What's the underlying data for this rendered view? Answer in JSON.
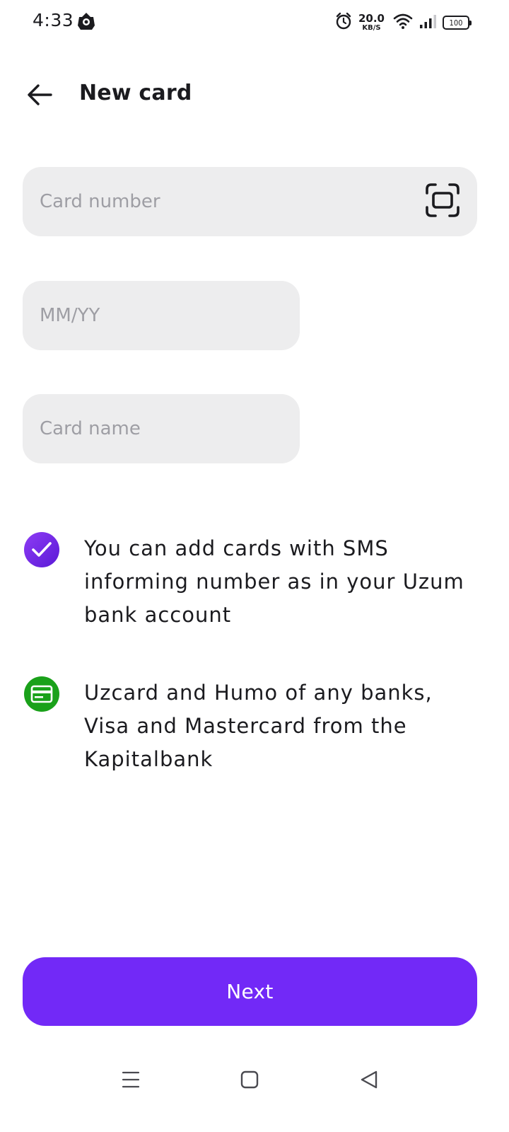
{
  "status_bar": {
    "time": "4:33",
    "net_speed_value": "20.0",
    "net_speed_unit": "KB/S",
    "battery_level": "100",
    "icons": [
      "app-notification-icon",
      "alarm-icon",
      "wifi-icon",
      "signal-icon",
      "battery-icon"
    ]
  },
  "header": {
    "title": "New card",
    "back_icon": "arrow-left-icon"
  },
  "form": {
    "card_number": {
      "value": "",
      "placeholder": "Card number",
      "scan_icon": "scan-card-icon"
    },
    "expiry": {
      "value": "",
      "placeholder": "MM/YY"
    },
    "card_name": {
      "value": "",
      "placeholder": "Card name"
    }
  },
  "info": [
    {
      "icon": "check-icon",
      "color": "#7b2ff0",
      "text": "You can add cards with SMS informing number as in your Uzum bank account"
    },
    {
      "icon": "card-icon",
      "color": "#1aa11a",
      "text": "Uzcard and Humo of any banks, Visa and Mastercard from the Kapitalbank"
    }
  ],
  "actions": {
    "next_label": "Next"
  },
  "theme": {
    "accent": "#7229f7",
    "field_bg": "#ededee",
    "placeholder": "#9e9ea4"
  }
}
